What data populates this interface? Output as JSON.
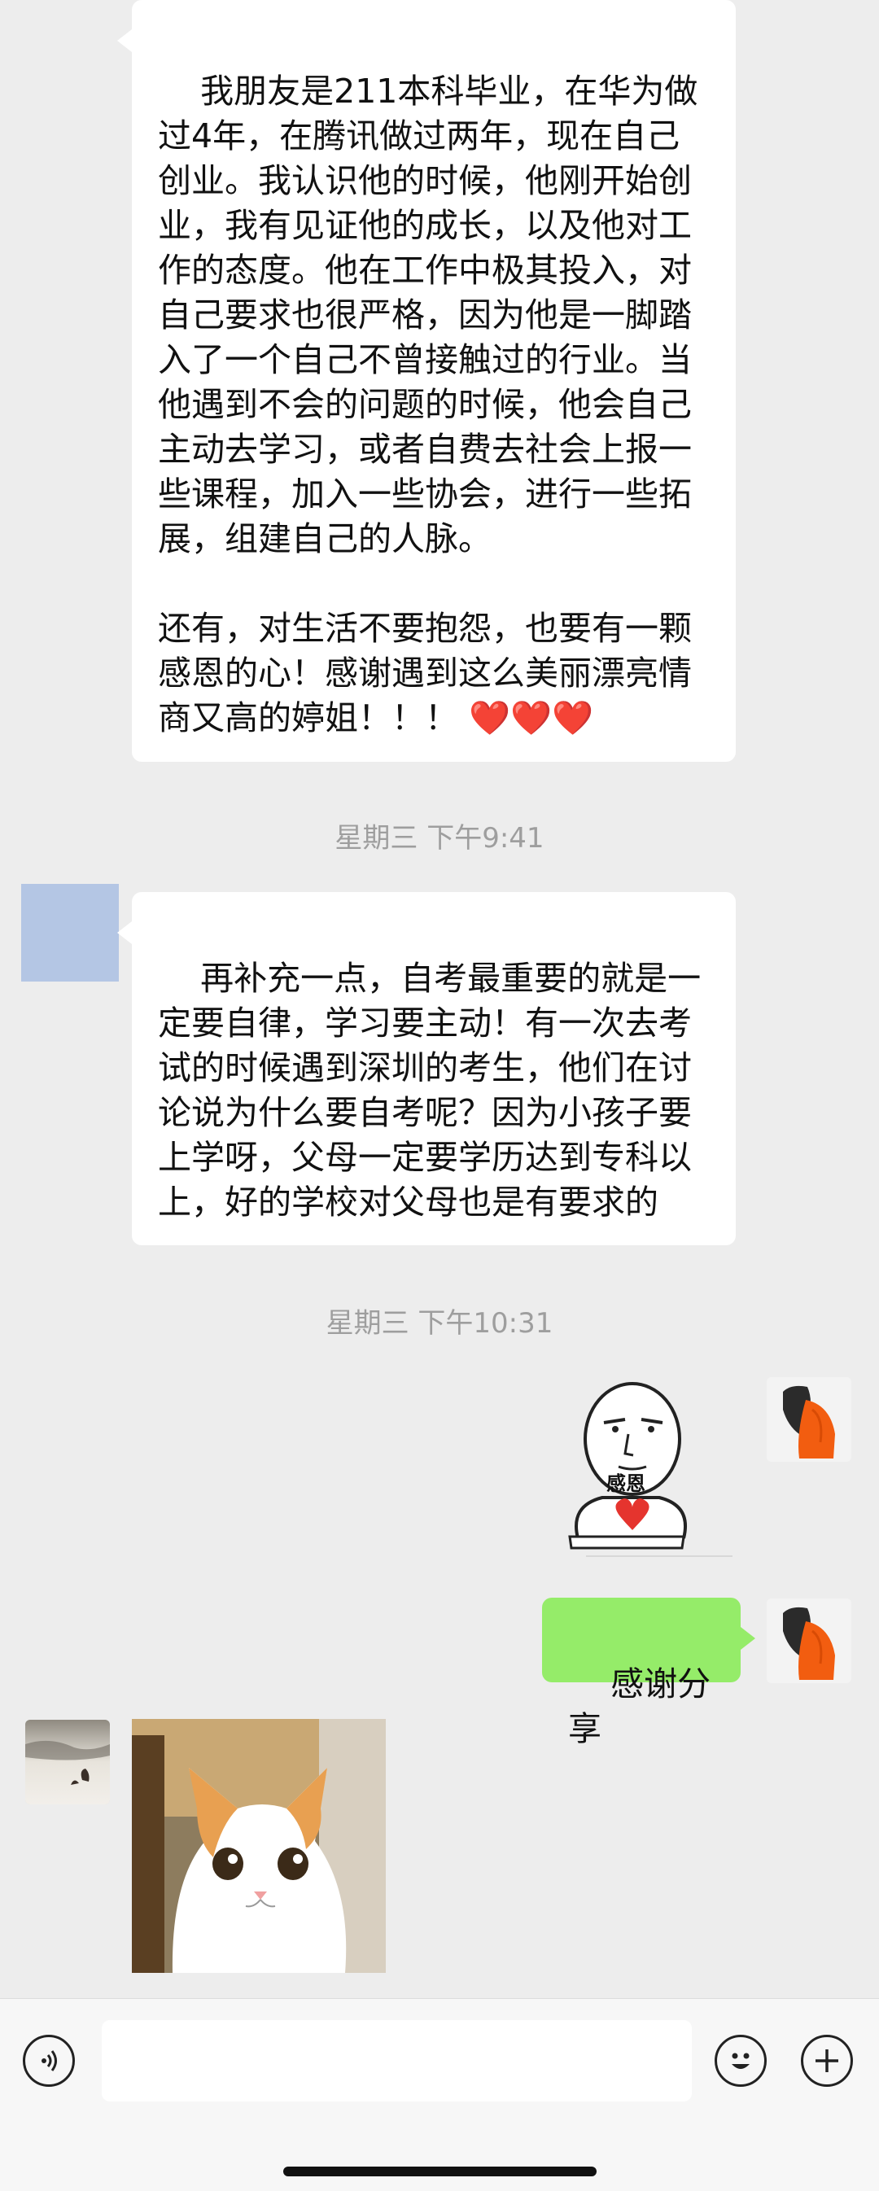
{
  "messages": {
    "m1_text": "我朋友是211本科毕业，在华为做过4年，在腾讯做过两年，现在自己创业。我认识他的时候，他刚开始创业，我有见证他的成长，以及他对工作的态度。他在工作中极其投入，对自己要求也很严格，因为他是一脚踏入了一个自己不曾接触过的行业。当他遇到不会的问题的时候，他会自己主动去学习，或者自费去社会上报一些课程，加入一些协会，进行一些拓展，组建自己的人脉。\n\n还有，对生活不要抱怨，也要有一颗感恩的心！感谢遇到这么美丽漂亮情商又高的婷姐！！！ ❤️❤️❤️",
    "ts1": "星期三 下午9:41",
    "m2_text": "再补充一点，自考最重要的就是一定要自律，学习要主动！有一次去考试的时候遇到深圳的考生，他们在讨论说为什么要自考呢？因为小孩子要上学呀，父母一定要学历达到专科以上，好的学校对父母也是有要求的",
    "ts2": "星期三 下午10:31",
    "sticker_text": "感恩",
    "m3_text": "感谢分享"
  },
  "colors": {
    "chat_bg": "#ededed",
    "outgoing_bubble": "#95ec69",
    "incoming_bubble": "#ffffff",
    "timestamp": "#9e9e9e"
  },
  "icons": {
    "voice": "voice-icon",
    "emoji": "emoji-icon",
    "plus": "plus-icon"
  }
}
